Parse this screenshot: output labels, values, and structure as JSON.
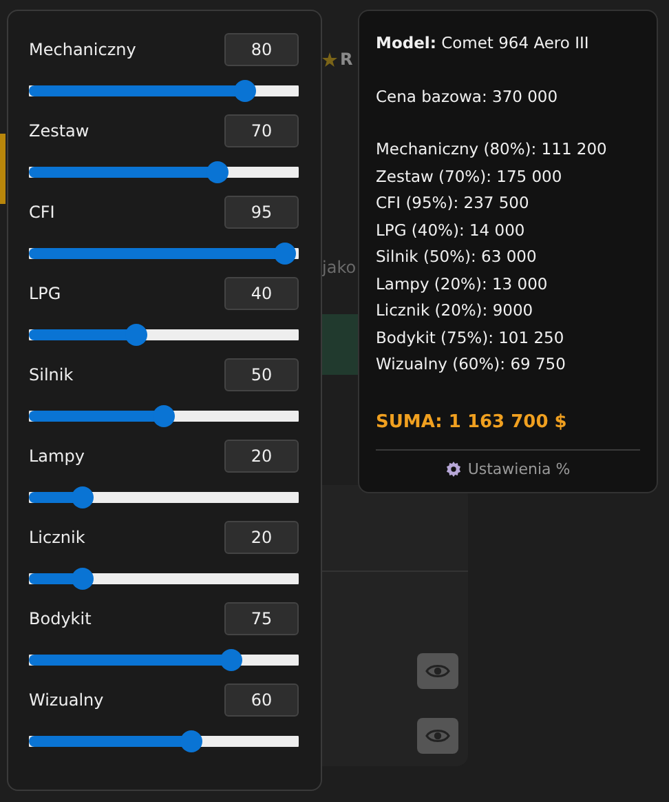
{
  "background": {
    "rating": "R",
    "note": "jako",
    "table_rows": [
      {
        "kind": "view"
      },
      {
        "kind": "view"
      }
    ]
  },
  "sliders": [
    {
      "label": "Mechaniczny",
      "value": "80",
      "level": 0.8
    },
    {
      "label": "Zestaw",
      "value": "70",
      "level": 0.7
    },
    {
      "label": "CFI",
      "value": "95",
      "level": 0.95
    },
    {
      "label": "LPG",
      "value": "40",
      "level": 0.4
    },
    {
      "label": "Silnik",
      "value": "50",
      "level": 0.5
    },
    {
      "label": "Lampy",
      "value": "20",
      "level": 0.2
    },
    {
      "label": "Licznik",
      "value": "20",
      "level": 0.2
    },
    {
      "label": "Bodykit",
      "value": "75",
      "level": 0.75
    },
    {
      "label": "Wizualny",
      "value": "60",
      "level": 0.6
    }
  ],
  "summary": {
    "model": "**Model:** Comet 964 Aero III",
    "base_price": "Cena bazowa: 370 000",
    "lines": [
      "Mechaniczny (80%): 111 200",
      "Zestaw (70%): 175 000",
      "CFI (95%): 237 500",
      "LPG (40%): 14 000",
      "Silnik (50%): 63 000",
      "Lampy (20%): 13 000",
      "Licznik (20%): 9000",
      "Bodykit (75%): 101 250",
      "Wizualny (60%): 69 750"
    ],
    "total": "SUMA: 1 163 700 $",
    "settings_link": "Ustawienia %"
  }
}
